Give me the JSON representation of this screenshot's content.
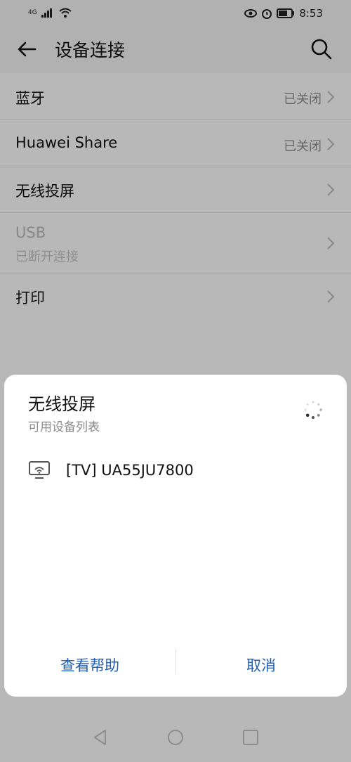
{
  "status": {
    "network": "4G",
    "time": "8:53"
  },
  "appbar": {
    "title": "设备连接"
  },
  "list": {
    "bluetooth": {
      "label": "蓝牙",
      "value": "已关闭"
    },
    "huawei_share": {
      "label": "Huawei Share",
      "value": "已关闭"
    },
    "wireless_projection": {
      "label": "无线投屏"
    },
    "usb": {
      "label": "USB",
      "sub": "已断开连接"
    },
    "print": {
      "label": "打印"
    }
  },
  "sheet": {
    "title": "无线投屏",
    "subtitle": "可用设备列表",
    "devices": [
      {
        "name": "[TV] UA55JU7800",
        "icon": "tv-cast-icon"
      }
    ],
    "help_label": "查看帮助",
    "cancel_label": "取消"
  },
  "colors": {
    "accent": "#1f5fb5",
    "overlay": "rgba(0,0,0,0.28)"
  }
}
